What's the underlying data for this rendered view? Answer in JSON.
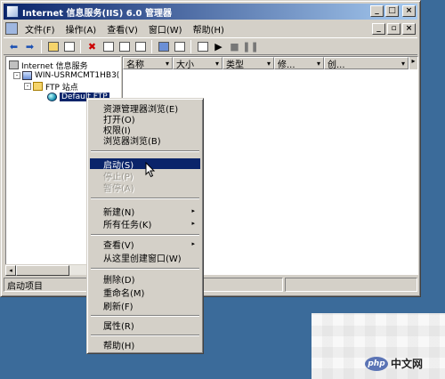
{
  "window": {
    "title": "Internet 信息服务(IIS) 6.0 管理器",
    "controls": {
      "minimize": "_",
      "maximize": "□",
      "close": "×"
    }
  },
  "menubar": {
    "items": [
      "文件(F)",
      "操作(A)",
      "查看(V)",
      "窗口(W)",
      "帮助(H)"
    ],
    "mdi_controls": {
      "minimize": "_",
      "restore": "▫",
      "close": "×"
    }
  },
  "toolbar": {
    "icons": [
      "back-icon",
      "forward-icon",
      "up-icon",
      "show-tree-icon",
      "delete-icon",
      "properties-icon",
      "refresh-icon",
      "export-icon",
      "help-icon",
      "console-icon",
      "computer-icon",
      "play-icon",
      "stop-icon",
      "pause-icon"
    ],
    "glyphs": {
      "back": "⬅",
      "forward": "➡",
      "delete": "✖",
      "play": "▶",
      "stop": "■",
      "pause": "❚❚"
    }
  },
  "tree": {
    "items": [
      {
        "label": "Internet 信息服务",
        "level": 0,
        "icon": "server-icon"
      },
      {
        "label": "WIN-USRMCMT1HB3(",
        "level": 1,
        "icon": "computer-icon",
        "expander": "-"
      },
      {
        "label": "FTP 站点",
        "level": 2,
        "icon": "folder-icon",
        "expander": "-"
      },
      {
        "label": "Default FTP",
        "level": 3,
        "icon": "ftp-site-icon",
        "selected": true
      }
    ]
  },
  "list": {
    "columns": [
      "名称",
      "大小",
      "类型",
      "修...",
      "创..."
    ],
    "scroll_glyph": "▸"
  },
  "scrollbar": {
    "left": "◂",
    "right": "▸"
  },
  "statusbar": {
    "text": "启动项目"
  },
  "context_menu": {
    "items": [
      {
        "label": "资源管理器浏览(E)",
        "state": "normal"
      },
      {
        "label": "打开(O)",
        "state": "normal"
      },
      {
        "label": "权限(I)",
        "state": "normal"
      },
      {
        "label": "浏览器浏览(B)",
        "state": "normal"
      },
      {
        "separator": true
      },
      {
        "label": "启动(S)",
        "state": "highlight"
      },
      {
        "label": "停止(P)",
        "state": "disabled"
      },
      {
        "label": "暂停(A)",
        "state": "disabled"
      },
      {
        "separator": true
      },
      {
        "label": "新建(N)",
        "state": "normal",
        "submenu": true
      },
      {
        "label": "所有任务(K)",
        "state": "normal",
        "submenu": true
      },
      {
        "separator": true
      },
      {
        "label": "查看(V)",
        "state": "normal",
        "submenu": true
      },
      {
        "label": "从这里创建窗口(W)",
        "state": "normal"
      },
      {
        "separator": true
      },
      {
        "label": "删除(D)",
        "state": "normal"
      },
      {
        "label": "重命名(M)",
        "state": "normal"
      },
      {
        "label": "刷新(F)",
        "state": "normal"
      },
      {
        "separator": true
      },
      {
        "label": "属性(R)",
        "state": "normal"
      },
      {
        "separator": true
      },
      {
        "label": "帮助(H)",
        "state": "normal"
      }
    ],
    "submenu_glyph": "▸"
  },
  "watermark": {
    "logo": "php",
    "text": "中文网"
  },
  "colors": {
    "desktop": "#3b6b9a",
    "titlebar_start": "#0a246a",
    "titlebar_end": "#a6caf0",
    "face": "#d4d0c8",
    "highlight": "#0a246a"
  }
}
